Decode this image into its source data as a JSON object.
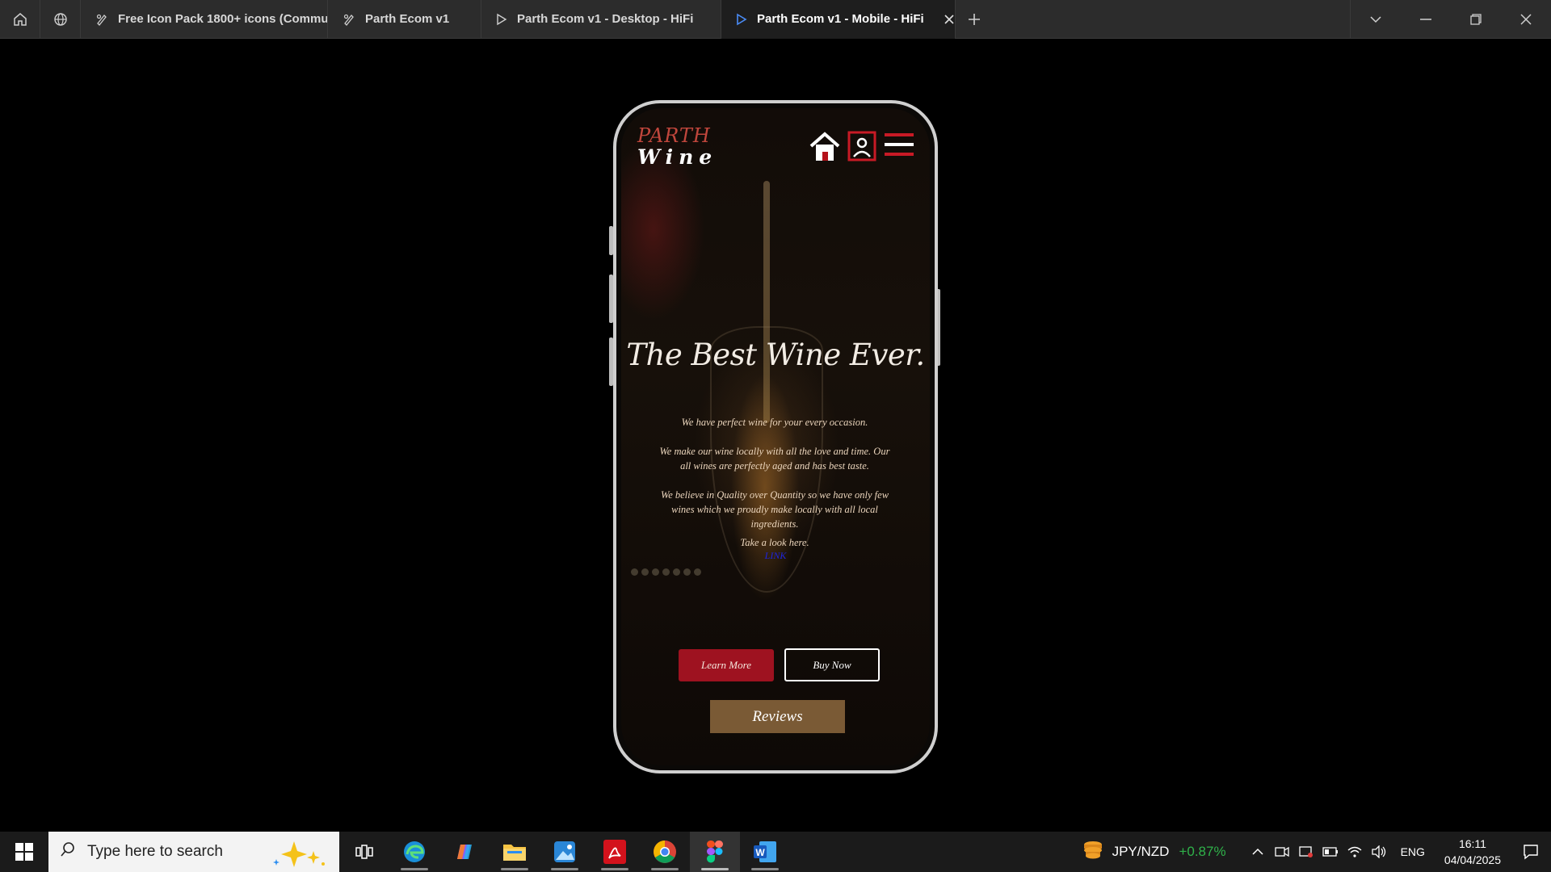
{
  "tabs": [
    {
      "label": "Free Icon Pack 1800+ icons (Commun",
      "icon": "figma-file-icon"
    },
    {
      "label": "Parth Ecom v1",
      "icon": "figma-file-icon"
    },
    {
      "label": "Parth Ecom v1 - Desktop - HiFi",
      "icon": "play-prototype-icon"
    },
    {
      "label": "Parth Ecom v1 - Mobile - HiFi",
      "icon": "play-prototype-icon",
      "active": true
    }
  ],
  "site": {
    "logo_line1": "PARTH",
    "logo_line2": "Wine",
    "hero_title": "The Best Wine Ever.",
    "para1": "We have perfect wine for your every occasion.",
    "para2": "We make our wine locally with all the love and time. Our all wines are perfectly aged and has best taste.",
    "para3": "We believe in Quality over Quantity so we have only few wines which we proudly make locally with all local ingredients.",
    "para4": "Take a look here.",
    "link": "LINK",
    "learn_more": "Learn More",
    "buy_now": "Buy Now",
    "reviews": "Reviews"
  },
  "taskbar": {
    "search_placeholder": "Type here to search",
    "fx_pair": "JPY/NZD",
    "fx_change": "+0.87%",
    "lang": "ENG",
    "time": "16:11",
    "date": "04/04/2025"
  },
  "colors": {
    "brand_red": "#9e1220",
    "reviews_brown": "#7a5a35",
    "logo_red": "#c0463c",
    "fx_green": "#2fb24a"
  }
}
